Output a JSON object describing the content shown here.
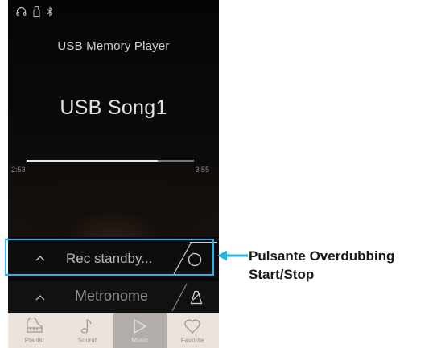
{
  "player": {
    "title": "USB Memory Player",
    "song": "USB Song1",
    "elapsed": "2:53",
    "total": "3:55",
    "progress": 0.785
  },
  "status_icons": [
    "headphones-icon",
    "usb-icon",
    "bluetooth-icon"
  ],
  "rec_bar": {
    "label": "Rec standby...",
    "button_icon": "overdub-circle-icon"
  },
  "metronome_bar": {
    "label": "Metronome",
    "button_icon": "metronome-icon"
  },
  "tabs": [
    {
      "label": "Pianist",
      "icon": "grand-piano-icon",
      "active": false
    },
    {
      "label": "Sound",
      "icon": "music-note-icon",
      "active": false
    },
    {
      "label": "Music",
      "icon": "play-icon",
      "active": true
    },
    {
      "label": "Favorite",
      "icon": "heart-icon",
      "active": false
    }
  ],
  "callout": {
    "line1": "Pulsante Overdubbing",
    "line2": "Start/Stop"
  },
  "colors": {
    "accent": "#1fb6ea",
    "tabbar": "#ece2dc",
    "active_tab": "#b3aeac"
  }
}
